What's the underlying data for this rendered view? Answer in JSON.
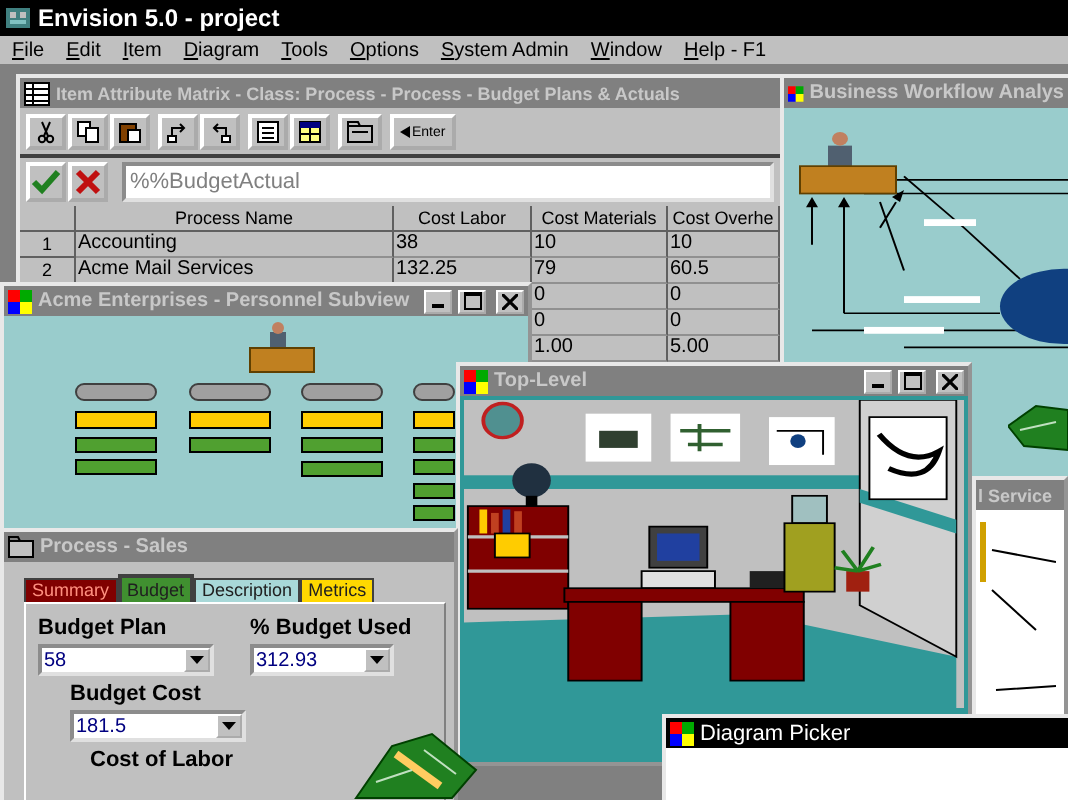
{
  "app": {
    "title": "Envision 5.0 - project",
    "active": true
  },
  "menu": [
    {
      "label": "File"
    },
    {
      "label": "Edit"
    },
    {
      "label": "Item"
    },
    {
      "label": "Diagram"
    },
    {
      "label": "Tools"
    },
    {
      "label": "Options"
    },
    {
      "label": "System Admin"
    },
    {
      "label": "Window"
    },
    {
      "label": "Help - F1"
    }
  ],
  "attribute_matrix": {
    "title": "Item Attribute Matrix - Class: Process - Process - Budget Plans & Actuals",
    "active": false,
    "enter_button": "Enter",
    "formula": "%%BudgetActual",
    "columns": [
      "Process Name",
      "Cost Labor",
      "Cost Materials",
      "Cost Overhe"
    ],
    "rows": [
      {
        "number": "1",
        "cells": [
          "Accounting",
          "38",
          "10",
          "10"
        ]
      },
      {
        "number": "2",
        "cells": [
          "Acme Mail Services",
          "132.25",
          "79",
          "60.5"
        ]
      },
      {
        "cells": [
          null,
          null,
          "0",
          "0"
        ]
      },
      {
        "cells": [
          null,
          null,
          "0",
          "0"
        ]
      },
      {
        "cells": [
          null,
          null,
          "1.00",
          "5.00"
        ]
      }
    ]
  },
  "business_workflow": {
    "title": "Business Workflow Analys",
    "active": false
  },
  "service_window": {
    "title": "l Service",
    "active": false
  },
  "personnel_subview": {
    "title": "Acme Enterprises - Personnel Subview",
    "active": false
  },
  "top_level": {
    "title": "Top-Level",
    "active": false
  },
  "process_sales": {
    "title": "Process - Sales",
    "active": false,
    "tabs": [
      {
        "label": "Summary",
        "selected": false,
        "color": "#800000"
      },
      {
        "label": "Budget",
        "selected": true,
        "color": "#409030"
      },
      {
        "label": "Description",
        "selected": false,
        "color": "#a8d8d8"
      },
      {
        "label": "Metrics",
        "selected": false,
        "color": "#ffd800"
      }
    ],
    "fields": [
      {
        "label": "Budget Plan",
        "value": "58"
      },
      {
        "label": "% Budget Used",
        "value": "312.93"
      },
      {
        "label": "Budget Cost",
        "value": "181.5"
      },
      {
        "label": "Cost of Labor"
      }
    ]
  },
  "diagram_picker": {
    "title": "Diagram Picker",
    "active": true
  }
}
